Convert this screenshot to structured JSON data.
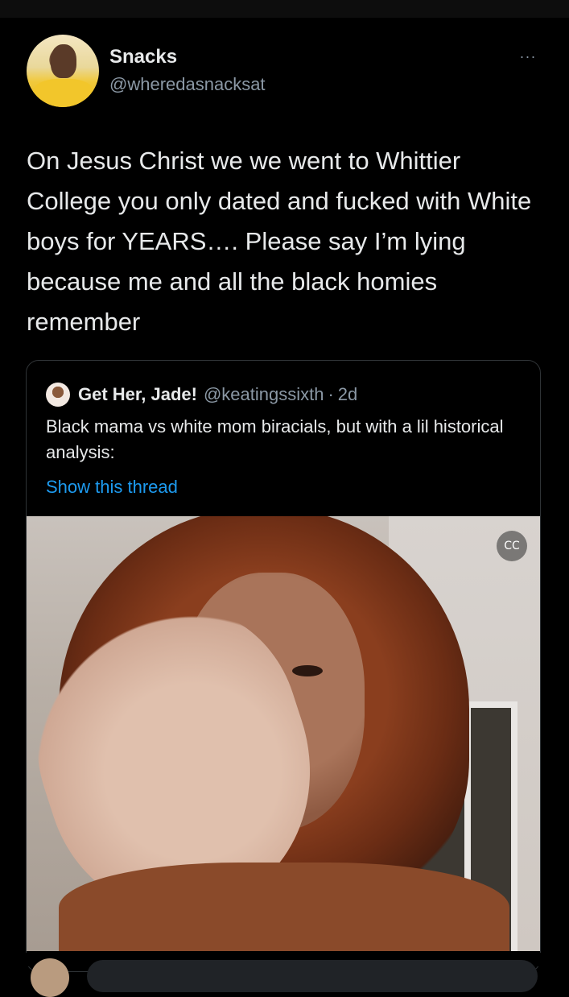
{
  "tweet": {
    "author_name": "Snacks",
    "author_handle": "@wheredasnacksat",
    "more_label": "···",
    "text": "On Jesus Christ we we went to Whittier College you only dated and fucked with White boys for YEARS…. Please say I’m lying because me and all the black homies remember"
  },
  "quote": {
    "author_name": "Get Her, Jade!",
    "author_handle": "@keatingssixth",
    "separator": "·",
    "time": "2d",
    "text": "Black mama vs white mom biracials, but with a lil historical analysis:",
    "show_thread_label": "Show this thread",
    "media": {
      "caption_icon_label": "CC"
    }
  },
  "colors": {
    "background": "#000000",
    "text_primary": "#e7e9ea",
    "text_secondary": "#8b98a5",
    "link": "#1d9bf0",
    "border": "#2f3336"
  }
}
